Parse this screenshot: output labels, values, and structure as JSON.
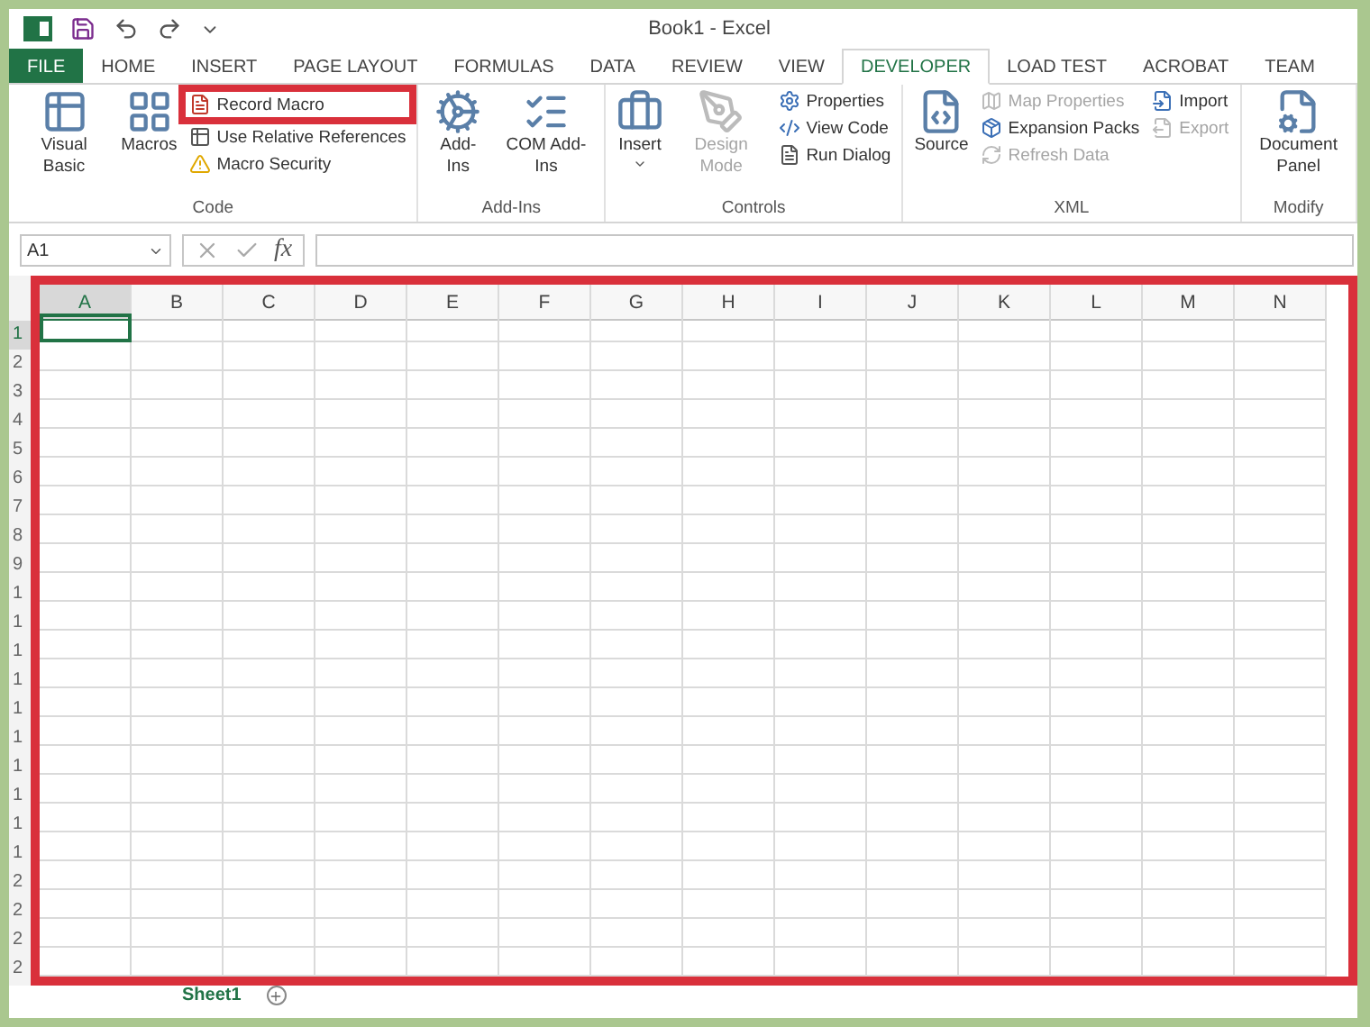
{
  "window": {
    "title": "Book1 - Excel"
  },
  "tabs": [
    {
      "label": "FILE",
      "kind": "file",
      "selected": false
    },
    {
      "label": "HOME",
      "kind": "tab",
      "selected": false
    },
    {
      "label": "INSERT",
      "kind": "tab",
      "selected": false
    },
    {
      "label": "PAGE LAYOUT",
      "kind": "tab",
      "selected": false
    },
    {
      "label": "FORMULAS",
      "kind": "tab",
      "selected": false
    },
    {
      "label": "DATA",
      "kind": "tab",
      "selected": false
    },
    {
      "label": "REVIEW",
      "kind": "tab",
      "selected": false
    },
    {
      "label": "VIEW",
      "kind": "tab",
      "selected": false
    },
    {
      "label": "DEVELOPER",
      "kind": "tab",
      "selected": true
    },
    {
      "label": "LOAD TEST",
      "kind": "tab",
      "selected": false
    },
    {
      "label": "ACROBAT",
      "kind": "tab",
      "selected": false
    },
    {
      "label": "TEAM",
      "kind": "tab",
      "selected": false
    }
  ],
  "ribbon": [
    {
      "name": "Code",
      "columns": [
        {
          "kind": "large",
          "label": "Visual Basic",
          "disabled": false
        },
        {
          "kind": "large",
          "label": "Macros",
          "disabled": false
        },
        {
          "kind": "stack",
          "items": [
            {
              "label": "Record Macro",
              "disabled": false,
              "highlighted": true
            },
            {
              "label": "Use Relative References",
              "disabled": false,
              "highlighted": false
            },
            {
              "label": "Macro Security",
              "disabled": false,
              "highlighted": false
            }
          ]
        }
      ]
    },
    {
      "name": "Add-Ins",
      "columns": [
        {
          "kind": "large",
          "label": "Add-Ins",
          "disabled": false
        },
        {
          "kind": "large",
          "label": "COM Add-Ins",
          "disabled": false
        }
      ]
    },
    {
      "name": "Controls",
      "columns": [
        {
          "kind": "large",
          "label": "Insert",
          "disabled": false,
          "dropdown": true
        },
        {
          "kind": "large",
          "label": "Design Mode",
          "disabled": true
        },
        {
          "kind": "stack",
          "items": [
            {
              "label": "Properties",
              "disabled": false,
              "highlighted": false
            },
            {
              "label": "View Code",
              "disabled": false,
              "highlighted": false
            },
            {
              "label": "Run Dialog",
              "disabled": false,
              "highlighted": false
            }
          ]
        }
      ]
    },
    {
      "name": "XML",
      "columns": [
        {
          "kind": "large",
          "label": "Source",
          "disabled": false
        },
        {
          "kind": "stack",
          "items": [
            {
              "label": "Map Properties",
              "disabled": true,
              "highlighted": false
            },
            {
              "label": "Expansion Packs",
              "disabled": false,
              "highlighted": false
            },
            {
              "label": "Refresh Data",
              "disabled": true,
              "highlighted": false
            }
          ]
        },
        {
          "kind": "stack",
          "items": [
            {
              "label": "Import",
              "disabled": false,
              "highlighted": false
            },
            {
              "label": "Export",
              "disabled": true,
              "highlighted": false
            }
          ]
        }
      ]
    },
    {
      "name": "Modify",
      "columns": [
        {
          "kind": "large",
          "label": "Document Panel",
          "disabled": false
        }
      ]
    }
  ],
  "formula_bar": {
    "name_box": "A1",
    "fx": "fx"
  },
  "grid": {
    "columns": [
      {
        "label": "A",
        "selected": true
      },
      {
        "label": "B",
        "selected": false
      },
      {
        "label": "C",
        "selected": false
      },
      {
        "label": "D",
        "selected": false
      },
      {
        "label": "E",
        "selected": false
      },
      {
        "label": "F",
        "selected": false
      },
      {
        "label": "G",
        "selected": false
      },
      {
        "label": "H",
        "selected": false
      },
      {
        "label": "I",
        "selected": false
      },
      {
        "label": "J",
        "selected": false
      },
      {
        "label": "K",
        "selected": false
      },
      {
        "label": "L",
        "selected": false
      },
      {
        "label": "M",
        "selected": false
      },
      {
        "label": "N",
        "selected": false
      }
    ],
    "rows": [
      {
        "label": "1",
        "selected": true
      },
      {
        "label": "2",
        "selected": false
      },
      {
        "label": "3",
        "selected": false
      },
      {
        "label": "4",
        "selected": false
      },
      {
        "label": "5",
        "selected": false
      },
      {
        "label": "6",
        "selected": false
      },
      {
        "label": "7",
        "selected": false
      },
      {
        "label": "8",
        "selected": false
      },
      {
        "label": "9",
        "selected": false
      },
      {
        "label": "1",
        "selected": false
      },
      {
        "label": "1",
        "selected": false
      },
      {
        "label": "1",
        "selected": false
      },
      {
        "label": "1",
        "selected": false
      },
      {
        "label": "1",
        "selected": false
      },
      {
        "label": "1",
        "selected": false
      },
      {
        "label": "1",
        "selected": false
      },
      {
        "label": "1",
        "selected": false
      },
      {
        "label": "1",
        "selected": false
      },
      {
        "label": "1",
        "selected": false
      },
      {
        "label": "2",
        "selected": false
      },
      {
        "label": "2",
        "selected": false
      },
      {
        "label": "2",
        "selected": false
      },
      {
        "label": "2",
        "selected": false
      }
    ]
  },
  "sheets": [
    {
      "label": "Sheet1",
      "selected": true
    }
  ]
}
